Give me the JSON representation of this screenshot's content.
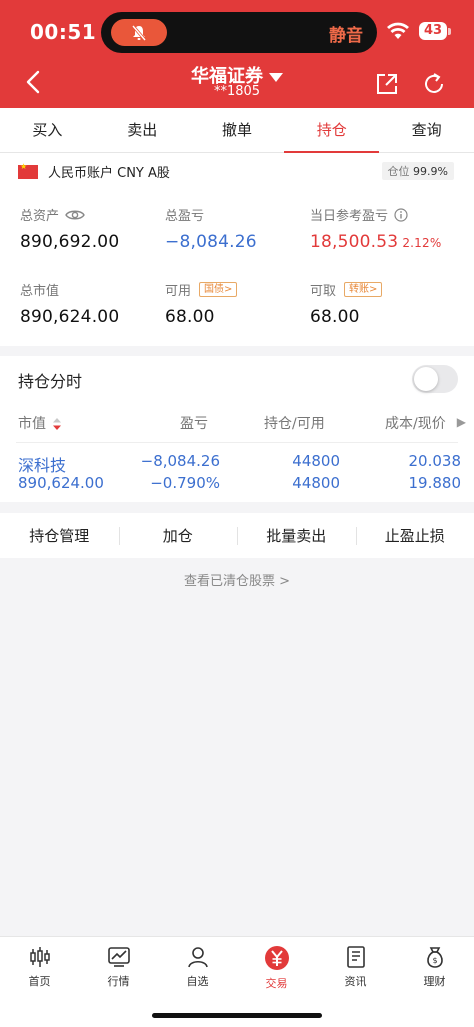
{
  "status": {
    "time": "00:51",
    "silent_label": "静音",
    "battery": "43"
  },
  "nav": {
    "title": "华福证券",
    "account_masked": "**1805"
  },
  "tabs": [
    {
      "label": "买入"
    },
    {
      "label": "卖出"
    },
    {
      "label": "撤单"
    },
    {
      "label": "持仓",
      "active": true
    },
    {
      "label": "查询"
    }
  ],
  "account": {
    "name": "人民币账户 CNY A股",
    "position_label": "仓位",
    "position_value": "99.9%",
    "total_assets_label": "总资产",
    "total_assets": "890,692.00",
    "total_pnl_label": "总盈亏",
    "total_pnl": "−8,084.26",
    "day_pnl_label": "当日参考盈亏",
    "day_pnl": "18,500.53",
    "day_pnl_pct": "2.12%",
    "market_value_label": "总市值",
    "market_value": "890,624.00",
    "available_label": "可用",
    "available_tag": "国债>",
    "available": "68.00",
    "withdrawable_label": "可取",
    "withdrawable_tag": "转账>",
    "withdrawable": "68.00"
  },
  "timeshare": {
    "label": "持仓分时",
    "enabled": false
  },
  "holdings": {
    "headers": {
      "market_value": "市值",
      "pnl": "盈亏",
      "position": "持仓/可用",
      "cost": "成本/现价"
    },
    "rows": [
      {
        "name": "深科技",
        "market_value": "890,624.00",
        "pnl": "−8,084.26",
        "pnl_pct": "−0.790%",
        "position": "44800",
        "available": "44800",
        "cost": "20.038",
        "price": "19.880"
      }
    ]
  },
  "actions": [
    {
      "label": "持仓管理"
    },
    {
      "label": "加仓"
    },
    {
      "label": "批量卖出"
    },
    {
      "label": "止盈止损"
    }
  ],
  "cleared_link": "查看已清仓股票 >",
  "bottom_nav": [
    {
      "label": "首页",
      "icon": "candlestick-icon"
    },
    {
      "label": "行情",
      "icon": "chart-icon"
    },
    {
      "label": "自选",
      "icon": "person-icon"
    },
    {
      "label": "交易",
      "icon": "yen-icon",
      "active": true
    },
    {
      "label": "资讯",
      "icon": "news-icon"
    },
    {
      "label": "理财",
      "icon": "money-bag-icon"
    }
  ],
  "colors": {
    "brand_red": "#e23a3a",
    "loss_blue": "#3c6fcf",
    "tag_orange": "#e8893a"
  }
}
